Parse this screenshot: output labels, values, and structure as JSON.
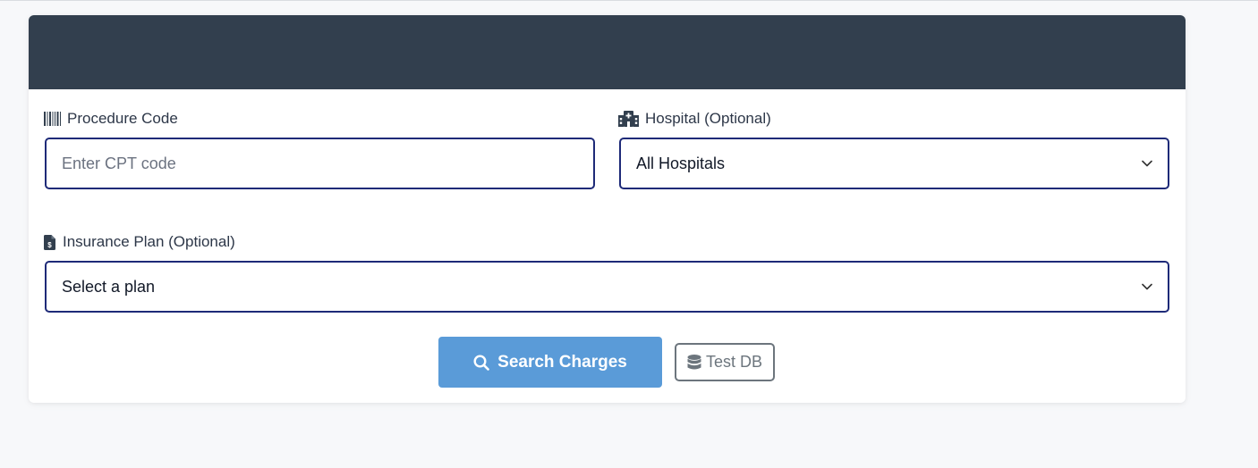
{
  "form": {
    "procedure": {
      "label": "Procedure Code",
      "icon": "barcode-icon",
      "placeholder": "Enter CPT code",
      "value": ""
    },
    "hospital": {
      "label": "Hospital (Optional)",
      "icon": "hospital-icon",
      "selected": "All Hospitals"
    },
    "insurance": {
      "label": "Insurance Plan (Optional)",
      "icon": "invoice-dollar-icon",
      "selected": "Select a plan"
    }
  },
  "actions": {
    "search_label": "Search Charges",
    "test_label": "Test DB"
  },
  "colors": {
    "header": "#323f4e",
    "primary": "#5a9bd8",
    "input_border": "#1e2a78",
    "secondary": "#6c757d",
    "background": "#f7f8fa"
  }
}
